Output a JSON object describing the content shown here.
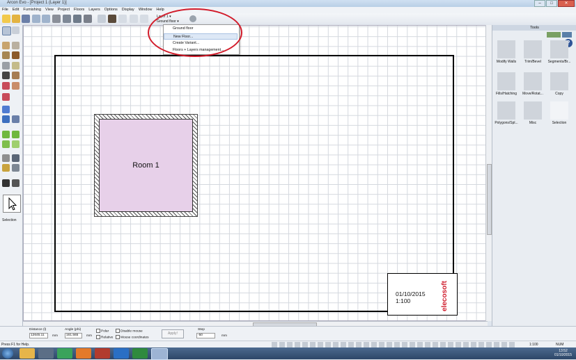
{
  "window": {
    "title": "Arcon Evo - [Project 1 (Layer 1)]",
    "min": "–",
    "max": "□",
    "close": "✕"
  },
  "menu": [
    "File",
    "Edit",
    "Furnishing",
    "View",
    "Project",
    "Floors",
    "Layers",
    "Options",
    "Display",
    "Window",
    "Help"
  ],
  "floor_selector": {
    "layer": "Layer 1",
    "floor": "Ground floor"
  },
  "dropdown": {
    "items": [
      "Ground floor",
      "New Floor...",
      "Create Variant...",
      "Floors + Layers management..."
    ],
    "highlighted_index": 1
  },
  "left_tools": {
    "selected_label": "Selection"
  },
  "canvas": {
    "room_label": "Room 1",
    "title_block": {
      "date": "01/10/2015",
      "scale": "1:100",
      "logo": "elecosoft"
    }
  },
  "right_panel": {
    "header": "Tools",
    "help": "?",
    "tools": [
      "Modify Walls",
      "Trim/Bevel",
      "Segments/Br...",
      "Fills/Hatching",
      "Move/Rotat...",
      "Copy",
      "Polygons/Spl...",
      "Misc",
      "Selection"
    ]
  },
  "input_bar": {
    "distance_label": "Distance (l)",
    "distance_value": "12645.11",
    "distance_unit": "mm",
    "angle_label": "Angle (phi)",
    "angle_value": "161.565",
    "angle_unit": "mm",
    "polar": "Polar",
    "relative": "Relative",
    "disable_mouse": "Disable mouse",
    "mouse_coords": "Mouse coordinates",
    "apply": "Apply!",
    "step_label": "Step",
    "step_value": "-50",
    "step_unit": "mm"
  },
  "status": {
    "help": "Press F1 for Help.",
    "scale": "1:100",
    "num": "NUM"
  },
  "taskbar": {
    "time": "13:52",
    "date": "01/10/2015"
  },
  "colors": {
    "accent_ellipse": "#d21b2a",
    "room_fill": "#e7d0e9",
    "logo": "#d01f2f"
  }
}
